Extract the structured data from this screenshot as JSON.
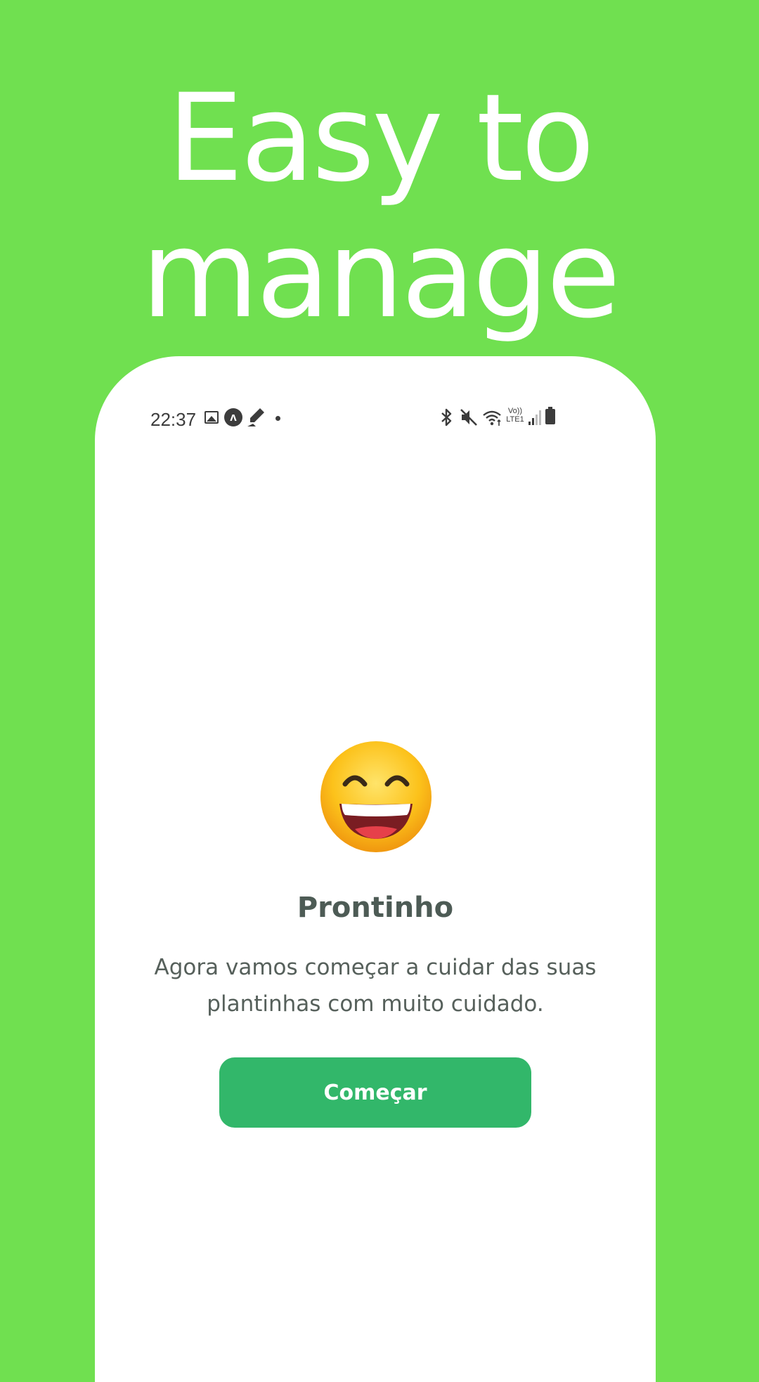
{
  "headline": {
    "line1": "Easy to",
    "line2": "manage"
  },
  "status_bar": {
    "time": "22:37",
    "icons": [
      "image-icon",
      "a-icon",
      "pen-icon",
      "dot-icon",
      "bluetooth-icon",
      "mute-icon",
      "wifi-icon",
      "volte-icon",
      "signal-icon",
      "battery-icon"
    ],
    "volte_line1": "Vo))",
    "volte_line2": "LTE1",
    "a_glyph": "ʌ"
  },
  "main": {
    "emoji": "grinning-face-with-smiling-eyes",
    "title": "Prontinho",
    "description": "Agora vamos começar a cuidar das suas plantinhas com muito cuidado.",
    "button_label": "Começar"
  },
  "colors": {
    "background": "#70e050",
    "phone_screen": "#ffffff",
    "button": "#32b76a",
    "title_text": "#4d5b55",
    "body_text": "#56605b"
  }
}
